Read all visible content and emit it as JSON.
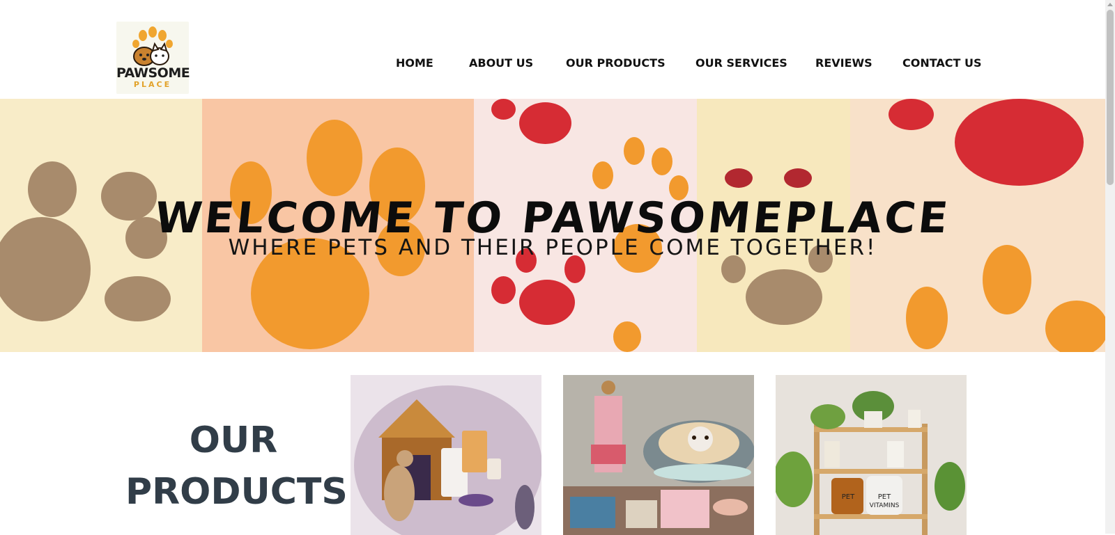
{
  "header": {
    "logo": {
      "name": "PAWSOME",
      "sub": "PLACE",
      "icon": "paw-dog-cat-logo"
    },
    "nav": [
      {
        "label": "HOME"
      },
      {
        "label": "ABOUT US"
      },
      {
        "label": "OUR PRODUCTS"
      },
      {
        "label": "OUR SERVICES"
      },
      {
        "label": "REVIEWS"
      },
      {
        "label": "CONTACT US"
      }
    ]
  },
  "hero": {
    "title": "WELCOME TO PAWSOMEPLACE",
    "subtitle": "WHERE PETS AND THEIR PEOPLE COME TOGETHER!"
  },
  "products": {
    "heading_line1": "OUR",
    "heading_line2": "PRODUCTS",
    "cards": [
      {
        "icon": "pet-food-and-house-illustration"
      },
      {
        "icon": "pet-clothing-and-bed-photo"
      },
      {
        "icon": "pet-vitamins-shelf-photo",
        "jar_label_1": "PET",
        "jar_label_2": "VITAMINS"
      }
    ]
  },
  "colors": {
    "heading": "#313d48",
    "paw_brown": "#a88b6c",
    "paw_orange": "#f29a2e",
    "paw_red": "#d62c34"
  }
}
